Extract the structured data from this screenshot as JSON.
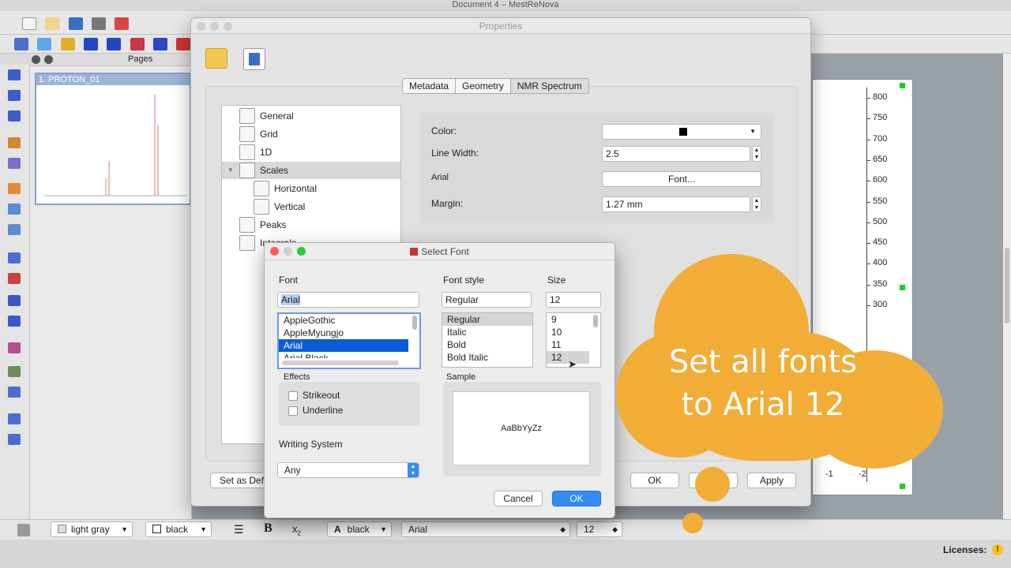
{
  "app": {
    "window_title": "Document 4 – MestReNova",
    "pages_panel_title": "Pages",
    "page_thumb_label": "1. PROTON_01"
  },
  "bottom_toolbar": {
    "fill_color": "light gray",
    "line_color": "black",
    "text_color": "black",
    "font_name": "Arial",
    "font_size": "12"
  },
  "status": {
    "licenses_label": "Licenses:"
  },
  "properties": {
    "title": "Properties",
    "tabs": [
      {
        "label": "Metadata"
      },
      {
        "label": "Geometry"
      },
      {
        "label": "NMR Spectrum"
      }
    ],
    "tree": [
      {
        "label": "General"
      },
      {
        "label": "Grid"
      },
      {
        "label": "1D"
      },
      {
        "label": "Scales"
      },
      {
        "label": "Horizontal"
      },
      {
        "label": "Vertical"
      },
      {
        "label": "Peaks"
      },
      {
        "label": "Integrals"
      }
    ],
    "fields": {
      "color_label": "Color:",
      "line_width_label": "Line Width:",
      "line_width_value": "2.5",
      "font_label": "Arial",
      "font_button": "Font...",
      "margin_label": "Margin:",
      "margin_value": "1.27 mm"
    },
    "buttons": {
      "set_default": "Set as Def",
      "ok": "OK",
      "apply": "Apply"
    }
  },
  "select_font": {
    "title": "Select Font",
    "font_header": "Font",
    "style_header": "Font style",
    "size_header": "Size",
    "font_value": "Arial",
    "style_value": "Regular",
    "size_value": "12",
    "fonts": [
      "AppleGothic",
      "AppleMyungjo",
      "Arial",
      "Arial Black"
    ],
    "styles": [
      "Regular",
      "Italic",
      "Bold",
      "Bold Italic"
    ],
    "sizes": [
      "9",
      "10",
      "11",
      "12"
    ],
    "effects_header": "Effects",
    "strikeout": "Strikeout",
    "underline": "Underline",
    "writing_system_header": "Writing System",
    "writing_system_value": "Any",
    "sample_header": "Sample",
    "sample_text": "AaBbYyZz",
    "cancel": "Cancel",
    "ok": "OK"
  },
  "overlay": {
    "line1": "Set all fonts",
    "line2": "to Arial 12"
  },
  "axis": {
    "ticks": [
      "800",
      "750",
      "700",
      "650",
      "600",
      "550",
      "500",
      "450",
      "400",
      "350",
      "300"
    ],
    "x_ticks": [
      "-1",
      "-2"
    ]
  },
  "colors": {
    "accent": "#2f8df4",
    "selection": "#0a5bd6",
    "overlay": "#f1ad36"
  }
}
